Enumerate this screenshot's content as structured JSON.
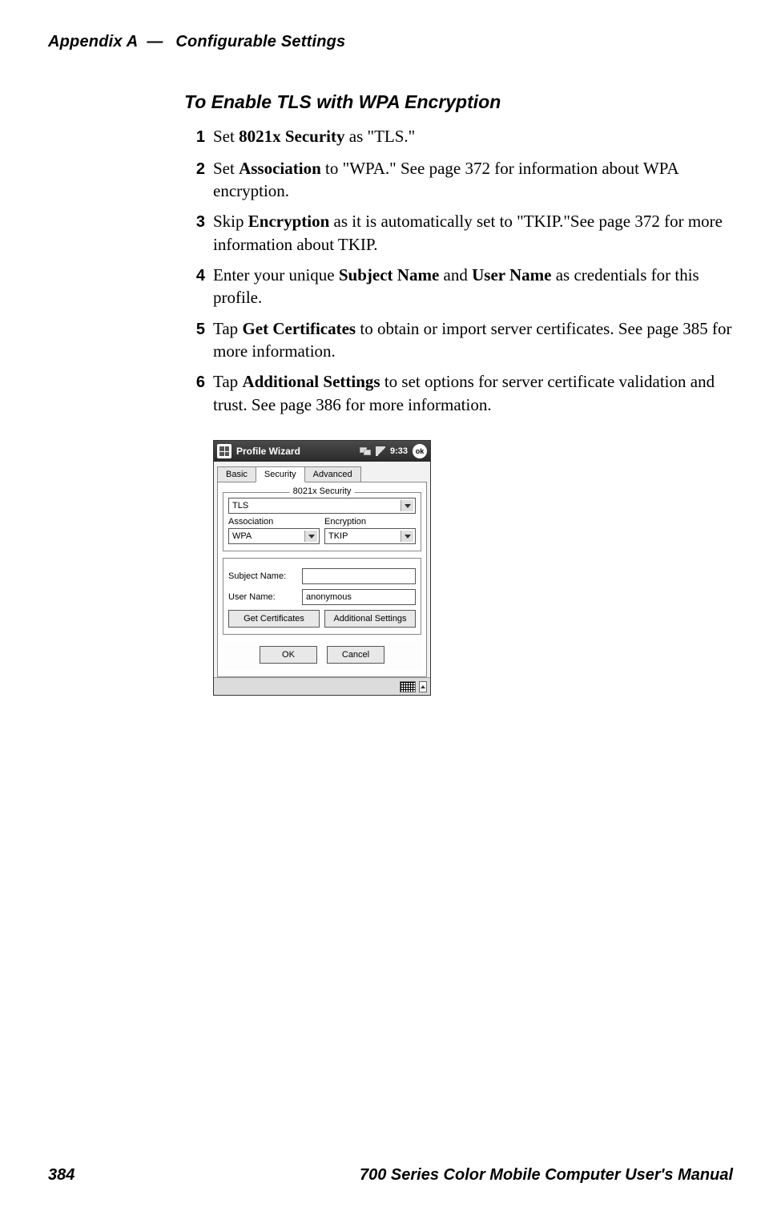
{
  "header": {
    "appendix": "Appendix  A",
    "dash": "—",
    "section": "Configurable Settings"
  },
  "title": "To Enable TLS with WPA Encryption",
  "steps": {
    "s1": {
      "num": "1",
      "a": "Set ",
      "b": "8021x Security",
      "c": " as \"TLS.\""
    },
    "s2": {
      "num": "2",
      "a": "Set ",
      "b": "Association",
      "c": " to \"WPA.\" See page 372 for information about WPA encryption."
    },
    "s3": {
      "num": "3",
      "a": "Skip ",
      "b": "Encryption",
      "c": " as it is automatically set to \"TKIP.\"See page 372 for more information about TKIP."
    },
    "s4": {
      "num": "4",
      "a": "Enter your unique ",
      "b": "Subject Name",
      "c": " and ",
      "d": "User Name",
      "e": " as credentials for this profile."
    },
    "s5": {
      "num": "5",
      "a": "Tap ",
      "b": "Get Certificates",
      "c": " to obtain or import server certificates. See page 385 for more information."
    },
    "s6": {
      "num": "6",
      "a": "Tap ",
      "b": "Additional Settings",
      "c": " to set options for server certificate validation and trust. See page 386 for more information."
    }
  },
  "device": {
    "title": "Profile Wizard",
    "clock": "9:33",
    "ok": "ok",
    "tabs": {
      "t1": "Basic",
      "t2": "Security",
      "t3": "Advanced"
    },
    "group_title": "8021x Security",
    "sec_value": "TLS",
    "assoc_label": "Association",
    "assoc_value": "WPA",
    "enc_label": "Encryption",
    "enc_value": "TKIP",
    "subj_label": "Subject Name:",
    "subj_value": "",
    "user_label": "User Name:",
    "user_value": "anonymous",
    "btn_getcert": "Get Certificates",
    "btn_addl": "Additional Settings",
    "btn_ok": "OK",
    "btn_cancel": "Cancel"
  },
  "footer": {
    "page": "384",
    "manual": "700 Series Color Mobile Computer User's Manual"
  }
}
